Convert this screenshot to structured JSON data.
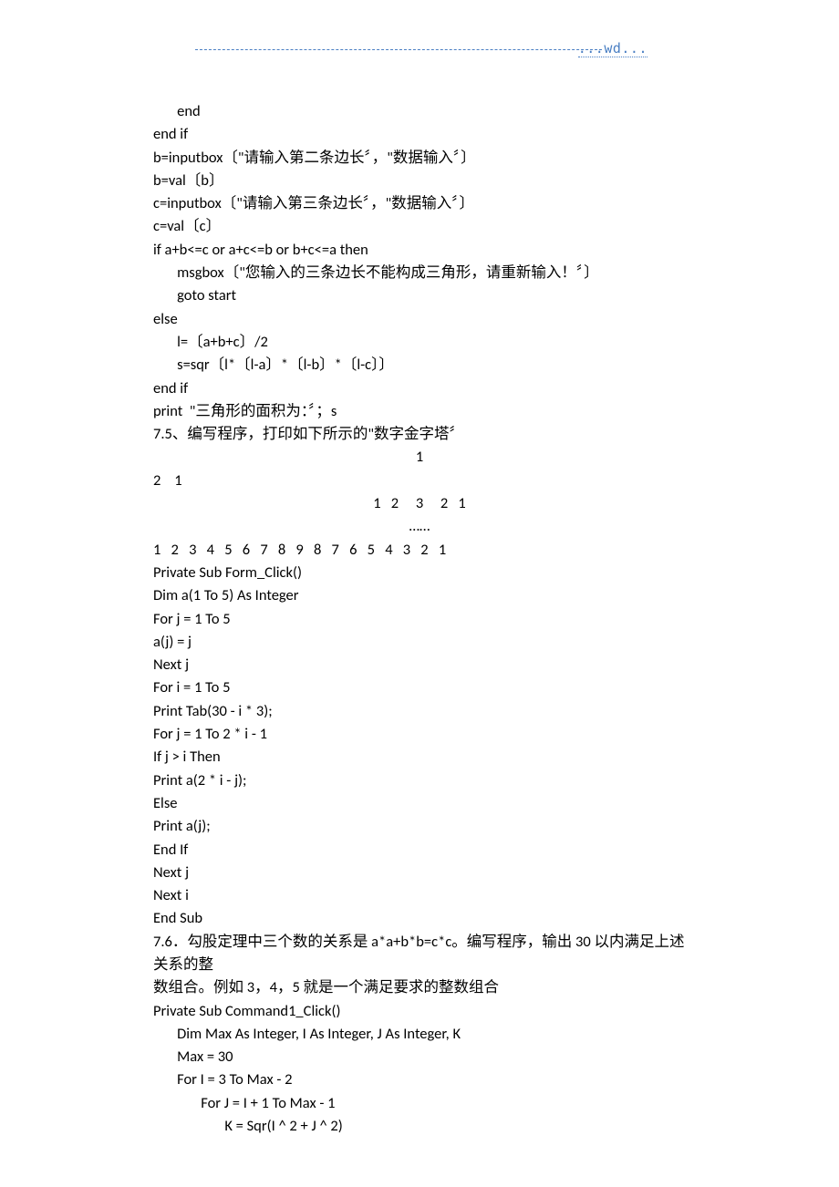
{
  "header": {
    "wd": "...wd..."
  },
  "lines": [
    {
      "t": "       end"
    },
    {
      "t": "end if"
    },
    {
      "t": "b=inputbox〔\"请输入第二条边长〞，\"数据输入〞〕"
    },
    {
      "t": "b=val〔b〕"
    },
    {
      "t": "c=inputbox〔\"请输入第三条边长〞，\"数据输入〞〕"
    },
    {
      "t": "c=val〔c〕"
    },
    {
      "t": "if a+b<=c or a+c<=b or b+c<=a then"
    },
    {
      "t": "       msgbox〔\"您输入的三条边长不能构成三角形，请重新输入！〞〕"
    },
    {
      "t": "       goto start"
    },
    {
      "t": "else"
    },
    {
      "t": "       l=〔a+b+c〕/2"
    },
    {
      "t": "       s=sqr〔l*〔l-a〕*〔l-b〕*〔l-c〕〕"
    },
    {
      "t": "end if"
    },
    {
      "t": "print  \"三角形的面积为：〞；s"
    },
    {
      "t": "7.5、编写程序，打印如下所示的\"数字金字塔〞"
    },
    {
      "t": "1",
      "center": true
    },
    {
      "t": "2    1"
    },
    {
      "t": "1   2     3     2   1",
      "center": true
    },
    {
      "t": "……",
      "center": true
    },
    {
      "t": "1   2   3   4   5   6   7   8   9   8   7   6   5   4   3   2   1"
    },
    {
      "t": "Private Sub Form_Click()"
    },
    {
      "t": "Dim a(1 To 5) As Integer"
    },
    {
      "t": "For j = 1 To 5"
    },
    {
      "t": "a(j) = j"
    },
    {
      "t": "Next j"
    },
    {
      "t": "For i = 1 To 5"
    },
    {
      "t": "Print Tab(30 - i * 3);"
    },
    {
      "t": "For j = 1 To 2 * i - 1"
    },
    {
      "t": "If j > i Then"
    },
    {
      "t": "Print a(2 * i - j);"
    },
    {
      "t": "Else"
    },
    {
      "t": "Print a(j);"
    },
    {
      "t": "End If"
    },
    {
      "t": "Next j"
    },
    {
      "t": "Next i"
    },
    {
      "t": "End Sub"
    },
    {
      "t": "7.6．勾股定理中三个数的关系是 a*a+b*b=c*c。编写程序，输出 30 以内满足上述关系的整",
      "wrap": true
    },
    {
      "t": "数组合。例如 3，4，5 就是一个满足要求的整数组合",
      "wrap": true
    },
    {
      "t": "Private Sub Command1_Click()"
    },
    {
      "t": "       Dim Max As Integer, I As Integer, J As Integer, K"
    },
    {
      "t": "       Max = 30"
    },
    {
      "t": "       For I = 3 To Max - 2"
    },
    {
      "t": "              For J = I + 1 To Max - 1"
    },
    {
      "t": "                     K = Sqr(I ^ 2 + J ^ 2)"
    }
  ]
}
